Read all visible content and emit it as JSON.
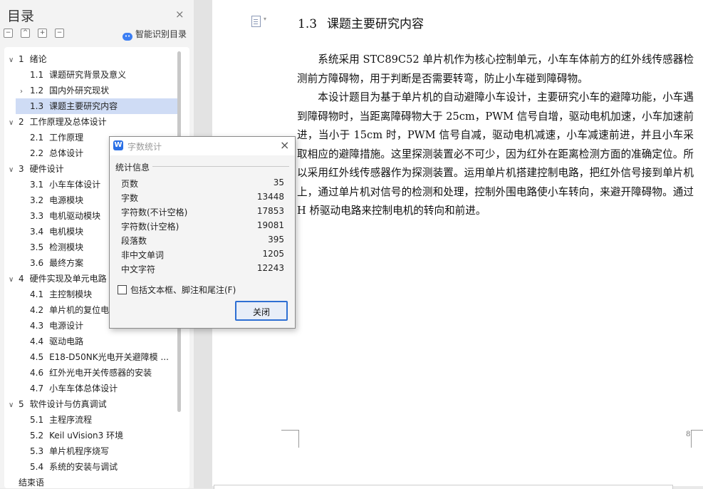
{
  "toc": {
    "title": "目录",
    "close_icon": "×",
    "toolbar": {
      "collapse_all": "−",
      "expand_up": "^",
      "add": "+",
      "remove": "−",
      "smart_label": "智能识别目录"
    },
    "items": [
      {
        "level": 1,
        "arrow": "∨",
        "num": "1",
        "label": "绪论"
      },
      {
        "level": 2,
        "arrow": "",
        "num": "1.1",
        "label": "课题研究背景及意义"
      },
      {
        "level": 2,
        "arrow": "›",
        "num": "1.2",
        "label": "国内外研究现状"
      },
      {
        "level": 2,
        "arrow": "",
        "num": "1.3",
        "label": "课题主要研究内容",
        "selected": true
      },
      {
        "level": 1,
        "arrow": "∨",
        "num": "2",
        "label": "工作原理及总体设计"
      },
      {
        "level": 2,
        "arrow": "",
        "num": "2.1",
        "label": "工作原理"
      },
      {
        "level": 2,
        "arrow": "",
        "num": "2.2",
        "label": "总体设计"
      },
      {
        "level": 1,
        "arrow": "∨",
        "num": "3",
        "label": "硬件设计"
      },
      {
        "level": 2,
        "arrow": "",
        "num": "3.1",
        "label": "小车车体设计"
      },
      {
        "level": 2,
        "arrow": "",
        "num": "3.2",
        "label": "电源模块"
      },
      {
        "level": 2,
        "arrow": "",
        "num": "3.3",
        "label": "电机驱动模块"
      },
      {
        "level": 2,
        "arrow": "",
        "num": "3.4",
        "label": "电机模块"
      },
      {
        "level": 2,
        "arrow": "",
        "num": "3.5",
        "label": "检测模块"
      },
      {
        "level": 2,
        "arrow": "",
        "num": "3.6",
        "label": "最终方案"
      },
      {
        "level": 1,
        "arrow": "∨",
        "num": "4",
        "label": "硬件实现及单元电路"
      },
      {
        "level": 2,
        "arrow": "",
        "num": "4.1",
        "label": "主控制模块"
      },
      {
        "level": 2,
        "arrow": "",
        "num": "4.2",
        "label": "单片机的复位电"
      },
      {
        "level": 2,
        "arrow": "",
        "num": "4.3",
        "label": "电源设计"
      },
      {
        "level": 2,
        "arrow": "",
        "num": "4.4",
        "label": "驱动电路"
      },
      {
        "level": 2,
        "arrow": "",
        "num": "4.5",
        "label": "E18-D50NK光电开关避障模 ..."
      },
      {
        "level": 2,
        "arrow": "",
        "num": "4.6",
        "label": "红外光电开关传感器的安装"
      },
      {
        "level": 2,
        "arrow": "",
        "num": "4.7",
        "label": "小车车体总体设计"
      },
      {
        "level": 1,
        "arrow": "∨",
        "num": "5",
        "label": "软件设计与仿真调试"
      },
      {
        "level": 2,
        "arrow": "",
        "num": "5.1",
        "label": "主程序流程"
      },
      {
        "level": 2,
        "arrow": "",
        "num": "5.2",
        "label": "Keil uVision3 环境"
      },
      {
        "level": 2,
        "arrow": "",
        "num": "5.3",
        "label": "单片机程序烧写"
      },
      {
        "level": 2,
        "arrow": "",
        "num": "5.4",
        "label": "系统的安装与调试"
      },
      {
        "level": 0,
        "arrow": "",
        "num": "",
        "label": "结束语"
      }
    ]
  },
  "doc": {
    "heading_num": "1.3",
    "heading_text": "课题主要研究内容",
    "paragraphs": [
      "系统采用 STC89C52 单片机作为核心控制单元，小车车体前方的红外线传感器检测前方障碍物，用于判断是否需要转弯，防止小车碰到障碍物。",
      "本设计题目为基于单片机的自动避障小车设计，主要研究小车的避障功能，小车遇到障碍物时，当距离障碍物大于 25cm，PWM 信号自增，驱动电机加速，小车加速前进，当小于 15cm 时，PWM 信号自减，驱动电机减速，小车减速前进，并且小车采取相应的避障措施。这里探测装置必不可少，因为红外在距离检测方面的准确定位。所以采用红外线传感器作为探测装置。运用单片机搭建控制电路，把红外信号接到单片机上，通过单片机对信号的检测和处理，控制外围电路使小车转向，来避开障碍物。通过 H 桥驱动电路来控制电机的转向和前进。"
    ],
    "page_number": "8"
  },
  "dialog": {
    "title": "字数统计",
    "logo": "W",
    "close_icon": "×",
    "section_label": "统计信息",
    "stats": [
      {
        "label": "页数",
        "value": "35"
      },
      {
        "label": "字数",
        "value": "13448"
      },
      {
        "label": "字符数(不计空格)",
        "value": "17853"
      },
      {
        "label": "字符数(计空格)",
        "value": "19081"
      },
      {
        "label": "段落数",
        "value": "395"
      },
      {
        "label": "非中文单词",
        "value": "1205"
      },
      {
        "label": "中文字符",
        "value": "12243"
      }
    ],
    "checkbox_label": "包括文本框、脚注和尾注(F)",
    "checkbox_checked": false,
    "close_button": "关闭"
  },
  "colors": {
    "selection": "#cfdcf5",
    "accent": "#2d6fd3"
  }
}
